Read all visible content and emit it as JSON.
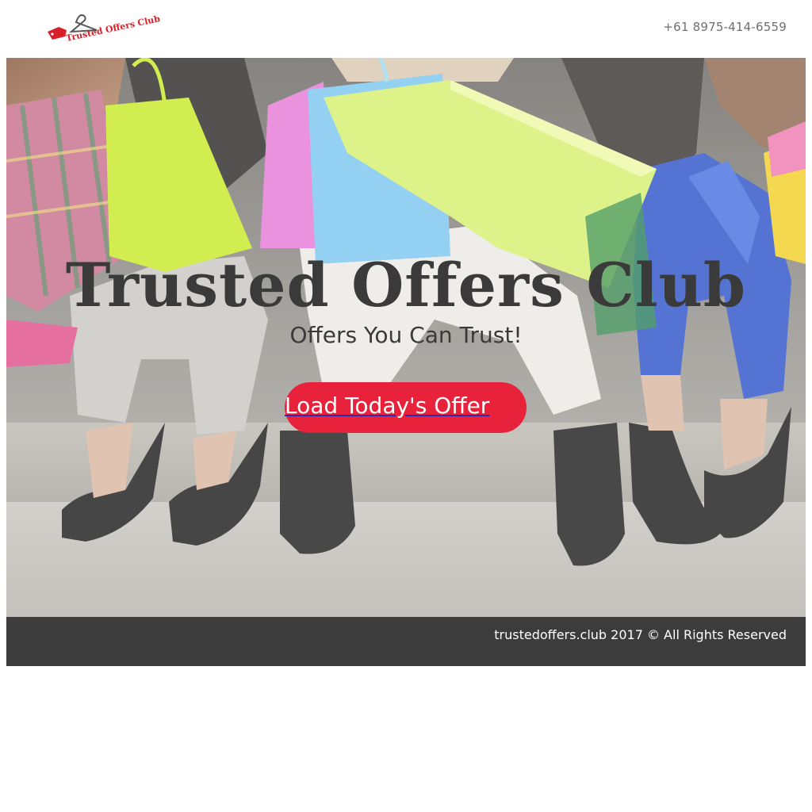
{
  "header": {
    "logo_text": "Trusted Offers Club",
    "phone": "+61 8975-414-6559"
  },
  "hero": {
    "title": "Trusted Offers Club",
    "subtitle": "Offers You Can Trust!",
    "cta_label": "Load Today's Offer"
  },
  "footer": {
    "copyright": "trustedoffers.club 2017 © All Rights Reserved"
  },
  "colors": {
    "accent": "#e8223a",
    "footer_bg": "#3c3c3c",
    "title": "#3a3a3a"
  }
}
